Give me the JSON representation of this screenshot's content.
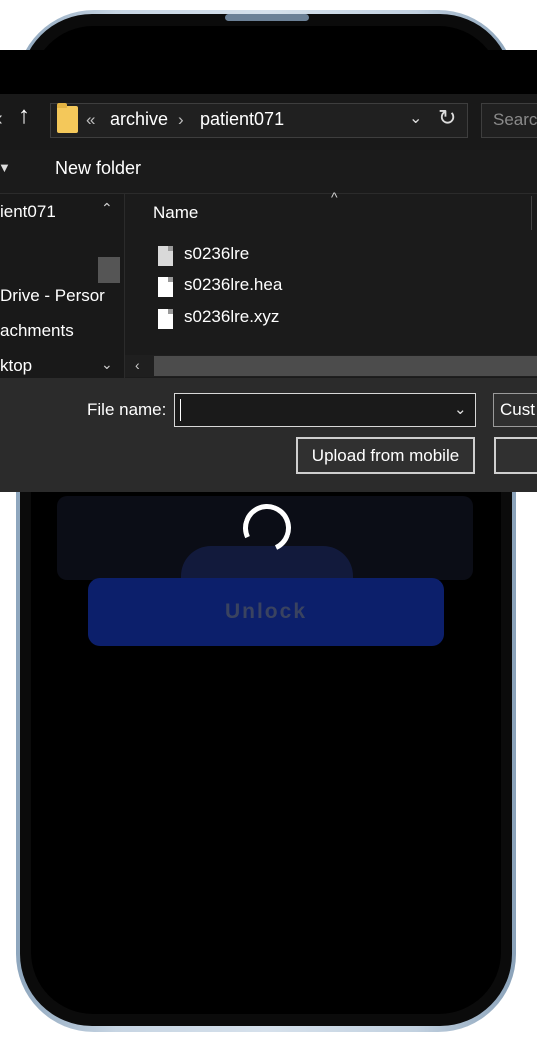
{
  "dialog": {
    "address": {
      "overflow_marker": "«",
      "segments": [
        "archive",
        "patient071"
      ],
      "separator": "›",
      "search_placeholder": "Searc"
    },
    "toolbar": {
      "new_folder_label": "New folder"
    },
    "nav_pane": {
      "items": [
        "ient071",
        "Drive - Persor",
        "achments",
        "ktop"
      ]
    },
    "file_list": {
      "column_name": "Name",
      "files": [
        "s0236lre",
        "s0236lre.hea",
        "s0236lre.xyz"
      ]
    },
    "bottom": {
      "file_name_label": "File name:",
      "file_name_value": "",
      "file_type_value": "Cust",
      "upload_label": "Upload from mobile"
    }
  },
  "app": {
    "unlock_label": "Unlock"
  },
  "colors": {
    "accent_blue": "#0c1f6b",
    "dialog_background": "#1b1b1b",
    "folder_yellow": "#f4c85a"
  }
}
